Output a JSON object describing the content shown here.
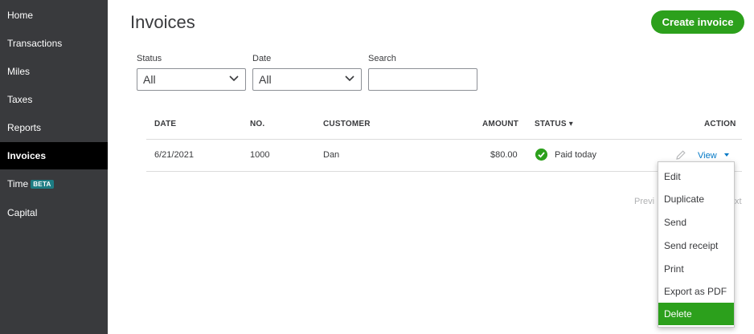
{
  "sidebar": {
    "items": [
      {
        "label": "Home"
      },
      {
        "label": "Transactions"
      },
      {
        "label": "Miles"
      },
      {
        "label": "Taxes"
      },
      {
        "label": "Reports"
      },
      {
        "label": "Invoices",
        "active": true
      },
      {
        "label": "Time",
        "badge": "BETA"
      },
      {
        "label": "Capital"
      }
    ]
  },
  "header": {
    "title": "Invoices",
    "create_label": "Create invoice"
  },
  "filters": {
    "status_label": "Status",
    "status_value": "All",
    "date_label": "Date",
    "date_value": "All",
    "search_label": "Search",
    "search_value": "",
    "search_placeholder": ""
  },
  "table": {
    "columns": [
      "DATE",
      "NO.",
      "CUSTOMER",
      "AMOUNT",
      "STATUS ▾",
      "ACTION"
    ],
    "rows": [
      {
        "date": "6/21/2021",
        "no": "1000",
        "customer": "Dan",
        "amount": "$80.00",
        "status": "Paid today",
        "action": "View"
      }
    ]
  },
  "pagination": {
    "prev_fragment": "Previ",
    "next_fragment": "xt"
  },
  "action_menu": {
    "items": [
      "Edit",
      "Duplicate",
      "Send",
      "Send receipt",
      "Print",
      "Export as PDF",
      "Delete"
    ],
    "highlighted": "Delete"
  },
  "colors": {
    "sidebar_bg": "#393a3d",
    "sidebar_active_bg": "#000000",
    "accent_green": "#2ca01c",
    "link_blue": "#0077c5",
    "badge_teal": "#1d7c83"
  },
  "icons": {
    "status": "check-circle-icon",
    "edit": "pencil-icon",
    "dropdown": "chevron-down-icon",
    "view_menu": "caret-down-icon"
  }
}
